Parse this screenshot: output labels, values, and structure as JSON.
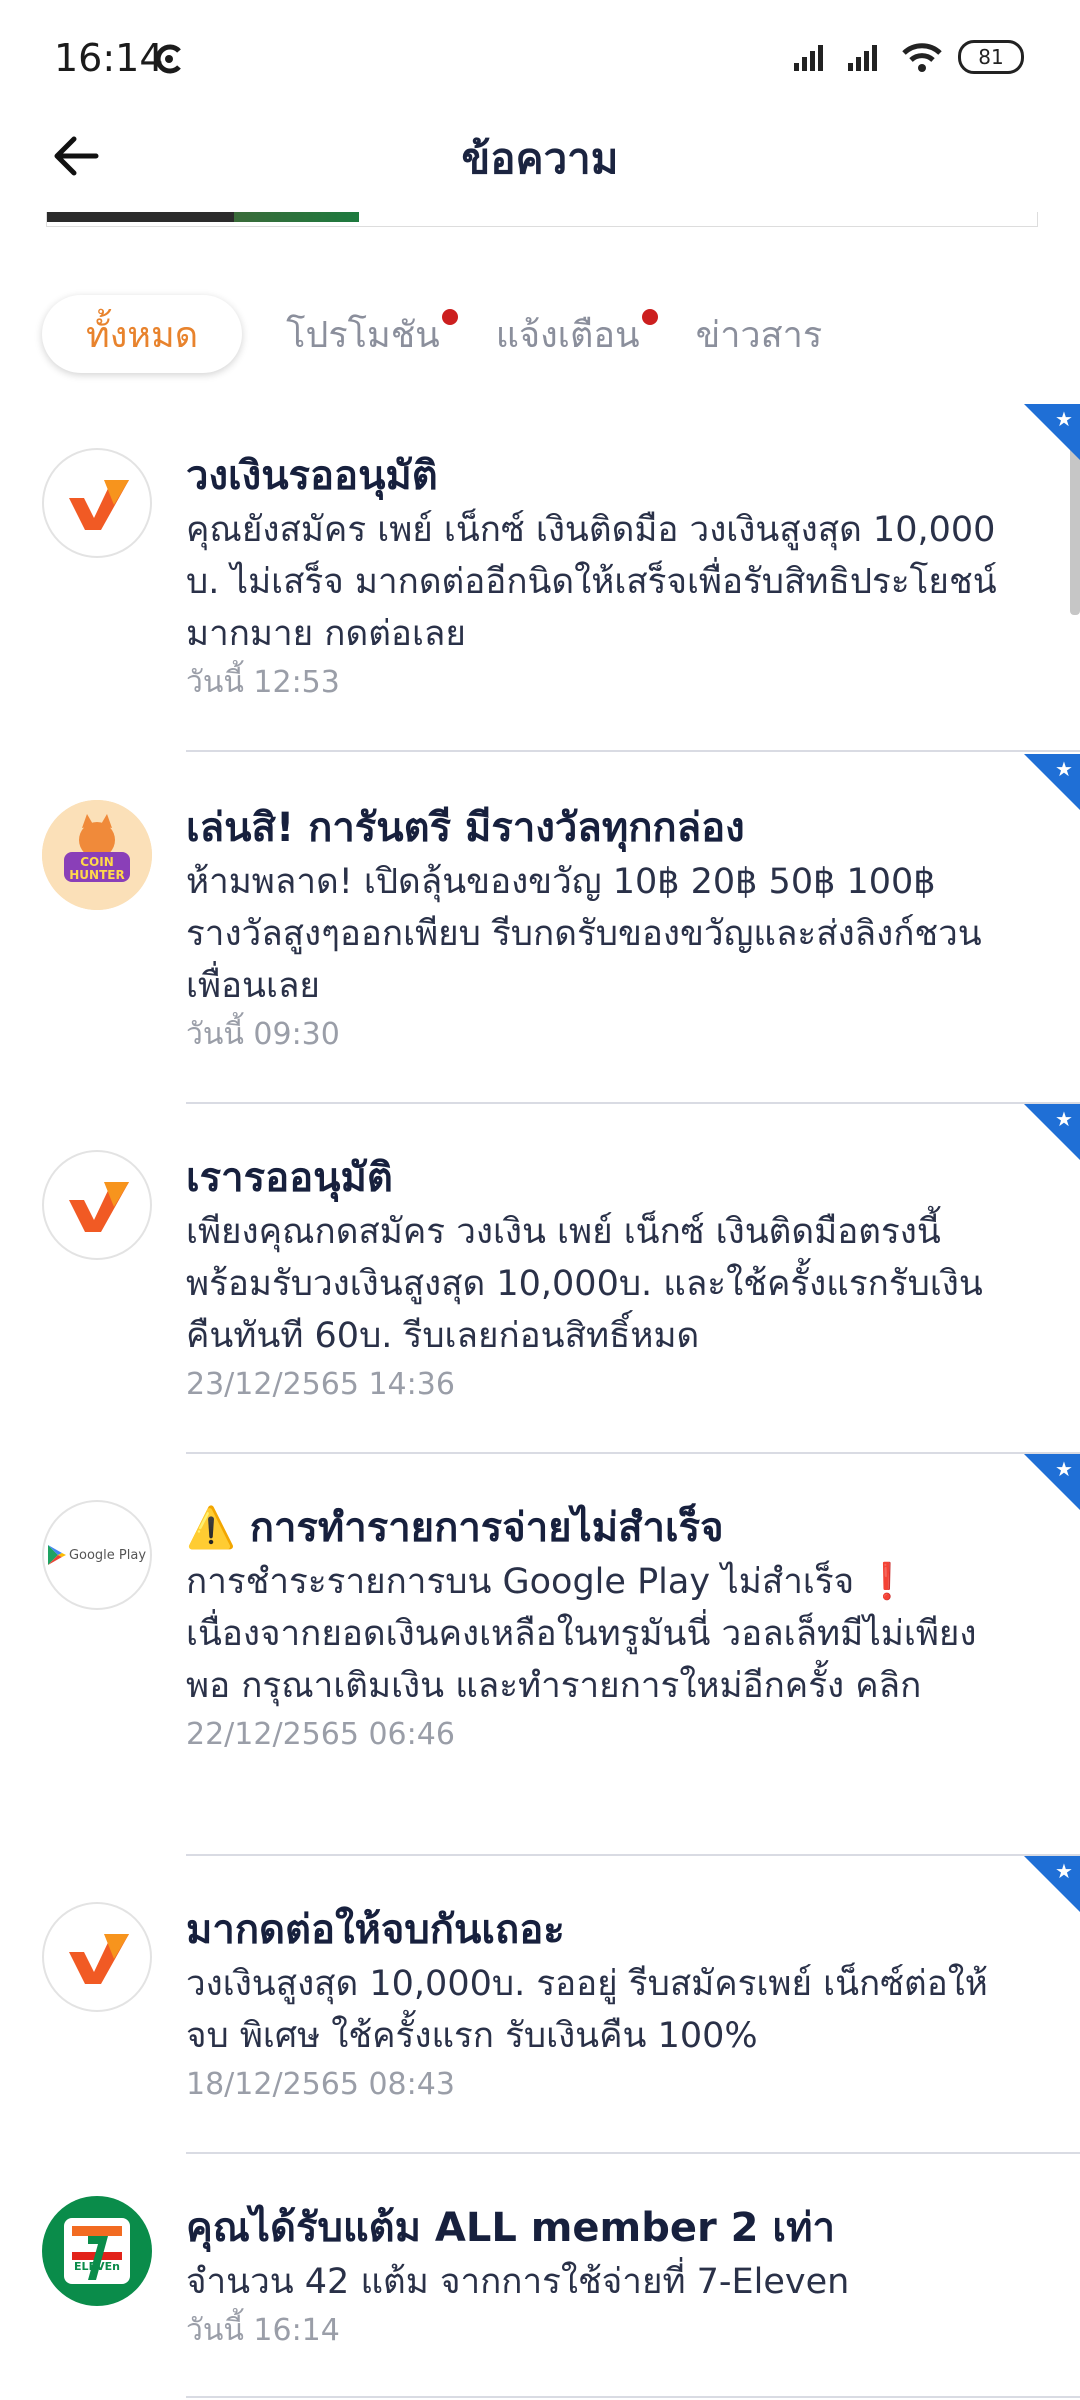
{
  "status_bar": {
    "time": "16:14",
    "battery": "81"
  },
  "header": {
    "title": "ข้อความ"
  },
  "tabs": [
    {
      "label": "ทั้งหมด",
      "active": true,
      "dot": false
    },
    {
      "label": "โปรโมชัน",
      "active": false,
      "dot": true
    },
    {
      "label": "แจ้งเตือน",
      "active": false,
      "dot": true
    },
    {
      "label": "ข่าวสาร",
      "active": false,
      "dot": false
    }
  ],
  "messages": [
    {
      "icon": "paynext-logo-icon",
      "title": "วงเงินรออนุมัติ",
      "text": "คุณยังสมัคร เพย์ เน็กซ์ เงินติดมือ วงเงินสูงสุด 10,000 บ. ไม่เสร็จ มากดต่ออีกนิดให้เสร็จเพื่อรับสิทธิประโยชน์มากมาย กดต่อเลย",
      "time": "วันนี้ 12:53",
      "starred": true
    },
    {
      "icon": "coin-hunter-icon",
      "title": "เล่นสิ! การันตรี มีรางวัลทุกกล่อง",
      "text": "ห้ามพลาด! เปิดลุ้นของขวัญ 10฿ 20฿ 50฿ 100฿ รางวัลสูงๆออกเพียบ รีบกดรับของขวัญและส่งลิงก์ชวนเพื่อนเลย",
      "time": "วันนี้ 09:30",
      "starred": true,
      "coin_text_1": "COIN",
      "coin_text_2": "HUNTER"
    },
    {
      "icon": "paynext-logo-icon",
      "title": "เรารออนุมัติ",
      "text": "เพียงคุณกดสมัคร วงเงิน เพย์ เน็กซ์ เงินติดมือตรงนี้ พร้อมรับวงเงินสูงสุด 10,000บ. และใช้ครั้งแรกรับเงินคืนทันที 60บ. รีบเลยก่อนสิทธิ์หมด",
      "time": "23/12/2565 14:36",
      "starred": true
    },
    {
      "icon": "google-play-icon",
      "title": "⚠️ การทำรายการจ่ายไม่สำเร็จ",
      "text": "การชำระรายการบน Google Play ไม่สำเร็จ ❗ เนื่องจากยอดเงินคงเหลือในทรูมันนี่ วอลเล็ทมีไม่เพียงพอ กรุณาเติมเงิน และทำรายการใหม่อีกครั้ง คลิก",
      "time": "22/12/2565 06:46",
      "starred": true,
      "google_label": "Google Play"
    },
    {
      "icon": "paynext-logo-icon",
      "title": "มากดต่อให้จบกันเถอะ",
      "text": "วงเงินสูงสุด 10,000บ. รออยู่ รีบสมัครเพย์ เน็กซ์ต่อให้จบ พิเศษ ใช้ครั้งแรก รับเงินคืน 100%",
      "time": "18/12/2565 08:43",
      "starred": true
    },
    {
      "icon": "seven-eleven-icon",
      "title": "คุณได้รับแต้ม ALL member 2 เท่า",
      "text": "จำนวน 42 แต้ม จากการใช้จ่ายที่ 7-Eleven",
      "time": "วันนี้ 16:14",
      "starred": false,
      "brand_label": "ELEVEn"
    }
  ],
  "colors": {
    "accent": "#e8832d",
    "dot": "#cc1f1f",
    "star_corner": "#1f6fd6",
    "title": "#17203d"
  }
}
